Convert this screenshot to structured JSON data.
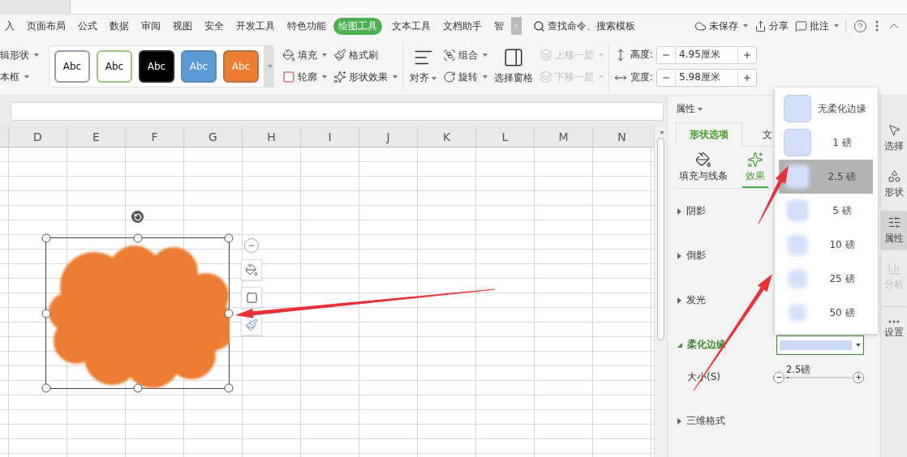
{
  "menu_tabs": [
    {
      "label": "入",
      "selected": false
    },
    {
      "label": "页面布局",
      "selected": false
    },
    {
      "label": "公式",
      "selected": false
    },
    {
      "label": "数据",
      "selected": false
    },
    {
      "label": "审阅",
      "selected": false
    },
    {
      "label": "视图",
      "selected": false
    },
    {
      "label": "安全",
      "selected": false
    },
    {
      "label": "开发工具",
      "selected": false
    },
    {
      "label": "特色功能",
      "selected": false
    },
    {
      "label": "绘图工具",
      "selected": true
    },
    {
      "label": "文本工具",
      "selected": false
    },
    {
      "label": "文档助手",
      "selected": false
    },
    {
      "label": "智",
      "selected": false
    }
  ],
  "search": {
    "placeholder": "查找命令、搜索模板"
  },
  "top_actions": [
    {
      "label": "未保存",
      "dropdown": true
    },
    {
      "label": "分享",
      "dropdown": false
    },
    {
      "label": "批注",
      "dropdown": true
    }
  ],
  "ribbon": {
    "edit_group": [
      {
        "label": "辑形状",
        "dropdown": true
      },
      {
        "label": "本框",
        "dropdown": true
      }
    ],
    "style_presets": [
      {
        "label": "Abc",
        "color": "#ffffff"
      },
      {
        "label": "Abc",
        "color": "#ffffff"
      },
      {
        "label": "Abc",
        "color": "#000000"
      },
      {
        "label": "Abc",
        "color": "#5b9bd5"
      },
      {
        "label": "Abc",
        "color": "#ed7d31"
      }
    ],
    "format_tools": [
      {
        "label": "填充",
        "dropdown": true
      },
      {
        "label": "格式刷",
        "dropdown": false
      },
      {
        "label": "轮廓",
        "dropdown": true
      },
      {
        "label": "形状效果",
        "dropdown": true
      }
    ],
    "arrange_tools": [
      {
        "label": "对齐",
        "kind": "large",
        "dropdown": true,
        "disabled": false
      },
      {
        "label": "组合",
        "kind": "small",
        "dropdown": true,
        "disabled": false
      },
      {
        "label": "旋转",
        "kind": "small",
        "dropdown": true,
        "disabled": false
      },
      {
        "label": "选择窗格",
        "kind": "large",
        "dropdown": false,
        "disabled": false
      },
      {
        "label": "上移一层",
        "kind": "small",
        "dropdown": true,
        "disabled": true
      },
      {
        "label": "下移一层",
        "kind": "small",
        "dropdown": true,
        "disabled": true
      }
    ],
    "size_fields": [
      {
        "label": "高度:",
        "value": "4.95厘米"
      },
      {
        "label": "宽度:",
        "value": "5.98厘米"
      }
    ]
  },
  "sheet": {
    "columns": [
      "D",
      "E",
      "F",
      "G",
      "H",
      "I",
      "J",
      "K",
      "L",
      "M",
      "N"
    ]
  },
  "panel": {
    "title": "属性",
    "tabs": [
      {
        "label": "形状选项",
        "selected": true
      },
      {
        "label": "文",
        "selected": false
      }
    ],
    "subtabs": [
      {
        "label": "填充与线条",
        "selected": false
      },
      {
        "label": "效果",
        "selected": true
      }
    ],
    "sections": [
      {
        "label": "阴影",
        "expanded": false
      },
      {
        "label": "倒影",
        "expanded": false
      },
      {
        "label": "发光",
        "expanded": false
      },
      {
        "label": "柔化边缘",
        "expanded": true,
        "size": {
          "label": "大小(S)",
          "reading": "2.5磅",
          "level": 0.05
        }
      },
      {
        "label": "三维格式",
        "expanded": false
      }
    ]
  },
  "dropdown": {
    "options": [
      {
        "label": "无柔化边缘",
        "selected": false
      },
      {
        "label": "1 磅",
        "selected": false
      },
      {
        "label": "2.5 磅",
        "selected": true
      },
      {
        "label": "5 磅",
        "selected": false
      },
      {
        "label": "10 磅",
        "selected": false
      },
      {
        "label": "25 磅",
        "selected": false
      },
      {
        "label": "50 磅",
        "selected": false
      }
    ]
  },
  "side_rail": [
    {
      "label": "选择",
      "selected": false,
      "disabled": false
    },
    {
      "label": "形状",
      "selected": false,
      "disabled": false
    },
    {
      "label": "属性",
      "selected": true,
      "disabled": false
    },
    {
      "label": "分析",
      "selected": false,
      "disabled": true
    },
    {
      "label": "设置",
      "selected": false,
      "disabled": false
    }
  ]
}
